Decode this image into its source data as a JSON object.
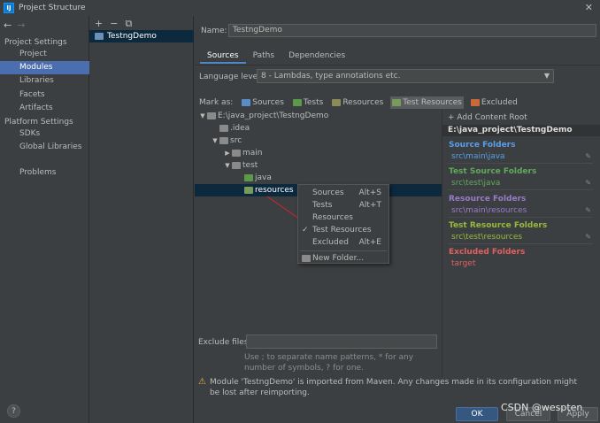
{
  "window": {
    "title": "Project Structure",
    "icon": "intellij-icon"
  },
  "left_nav": {
    "section_project": "Project Settings",
    "project_items": [
      "Project",
      "Modules",
      "Libraries",
      "Facets",
      "Artifacts"
    ],
    "section_platform": "Platform Settings",
    "platform_items": [
      "SDKs",
      "Global Libraries"
    ],
    "problems": "Problems",
    "active": "Modules"
  },
  "modules": {
    "items": [
      "TestngDemo"
    ]
  },
  "main": {
    "name_label": "Name:",
    "name_value": "TestngDemo",
    "tabs": [
      "Sources",
      "Paths",
      "Dependencies"
    ],
    "active_tab": "Sources",
    "language_label": "Language level:",
    "language_value": "8 - Lambdas, type annotations etc.",
    "mark_as_label": "Mark as:",
    "mark_as": [
      {
        "label": "Sources",
        "color": "#5c8cc8"
      },
      {
        "label": "Tests",
        "color": "#5a9a4a"
      },
      {
        "label": "Resources",
        "color": "#8a8a5a"
      },
      {
        "label": "Test Resources",
        "color": "#7a9a5a"
      },
      {
        "label": "Excluded",
        "color": "#c86a3a"
      }
    ],
    "tree": [
      {
        "label": "E:\\java_project\\TestngDemo",
        "depth": 0,
        "arrow": "▼"
      },
      {
        "label": ".idea",
        "depth": 1,
        "arrow": ""
      },
      {
        "label": "src",
        "depth": 1,
        "arrow": "▼"
      },
      {
        "label": "main",
        "depth": 2,
        "arrow": "▶"
      },
      {
        "label": "test",
        "depth": 2,
        "arrow": "▼"
      },
      {
        "label": "java",
        "depth": 3,
        "arrow": ""
      },
      {
        "label": "resources",
        "depth": 3,
        "arrow": ""
      }
    ],
    "exclude_label": "Exclude files:",
    "exclude_hint": "Use ; to separate name patterns, * for any number of symbols, ? for one.",
    "warning": "Module 'TestngDemo' is imported from Maven. Any changes made in its configuration might be lost after reimporting."
  },
  "context_menu": {
    "items": [
      {
        "label": "Sources",
        "shortcut": "Alt+S"
      },
      {
        "label": "Tests",
        "shortcut": "Alt+T"
      },
      {
        "label": "Resources",
        "shortcut": ""
      },
      {
        "label": "Test Resources",
        "shortcut": "",
        "checked": true
      },
      {
        "label": "Excluded",
        "shortcut": "Alt+E"
      }
    ],
    "new_folder": "New Folder..."
  },
  "content_roots": {
    "add": "+ Add Content Root",
    "root": "E:\\java_project\\TestngDemo",
    "groups": [
      {
        "title": "Source Folders",
        "value": "src\\main\\java",
        "color": "#5a9ee8"
      },
      {
        "title": "Test Source Folders",
        "value": "src\\test\\java",
        "color": "#62a85a"
      },
      {
        "title": "Resource Folders",
        "value": "src\\main\\resources",
        "color": "#9a7ac8"
      },
      {
        "title": "Test Resource Folders",
        "value": "src\\test\\resources",
        "color": "#9ab83a"
      },
      {
        "title": "Excluded Folders",
        "value": "target",
        "color": "#e06060"
      }
    ]
  },
  "buttons": {
    "ok": "OK",
    "cancel": "Cancel",
    "apply": "Apply"
  },
  "watermark": "CSDN @wespten"
}
